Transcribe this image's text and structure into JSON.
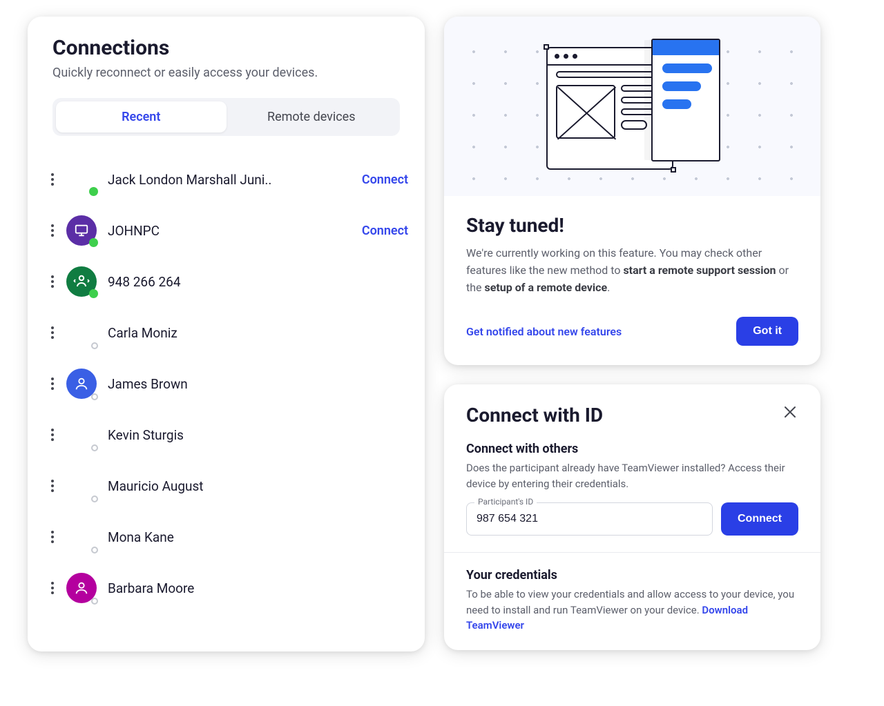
{
  "connections": {
    "title": "Connections",
    "subtitle": "Quickly reconnect or easily access your devices.",
    "tabs": {
      "recent": "Recent",
      "remote": "Remote devices"
    },
    "connectLabel": "Connect",
    "items": [
      {
        "name": "Jack London Marshall Juni..",
        "avatarType": "none",
        "status": "online",
        "showConnect": true
      },
      {
        "name": "JOHNPC",
        "avatarType": "monitor",
        "avatarColor": "#5b2ea6",
        "status": "online",
        "showConnect": true
      },
      {
        "name": "948 266 264",
        "avatarType": "swap",
        "avatarColor": "#107c41",
        "status": "online",
        "showConnect": false
      },
      {
        "name": "Carla Moniz",
        "avatarType": "none",
        "status": "offline",
        "showConnect": false
      },
      {
        "name": "James Brown",
        "avatarType": "person",
        "avatarColor": "#3a5fe5",
        "status": "offline",
        "showConnect": false
      },
      {
        "name": "Kevin Sturgis",
        "avatarType": "none",
        "status": "offline",
        "showConnect": false
      },
      {
        "name": "Mauricio August",
        "avatarType": "none",
        "status": "offline",
        "showConnect": false
      },
      {
        "name": "Mona Kane",
        "avatarType": "none",
        "status": "offline",
        "showConnect": false
      },
      {
        "name": "Barbara Moore",
        "avatarType": "person",
        "avatarColor": "#b4009e",
        "status": "offline",
        "showConnect": false
      }
    ]
  },
  "stayTuned": {
    "title": "Stay tuned!",
    "textPrefix": "We're currently working on this feature. You may check other features like the new method to ",
    "bold1": "start a remote support session",
    "textMid": " or the ",
    "bold2": "setup of a remote device",
    "textSuffix": ".",
    "notifyLink": "Get notified about new features",
    "gotIt": "Got it"
  },
  "connectId": {
    "title": "Connect with ID",
    "others": {
      "heading": "Connect with others",
      "text": "Does the participant already have TeamViewer installed? Access their device by entering their credentials.",
      "inputLabel": "Participant's ID",
      "inputValue": "987 654 321",
      "button": "Connect"
    },
    "creds": {
      "heading": "Your credentials",
      "text": "To be able to view your credentials and allow access to your device, you need to install and run TeamViewer on your device.  ",
      "link": "Download TeamViewer"
    }
  }
}
